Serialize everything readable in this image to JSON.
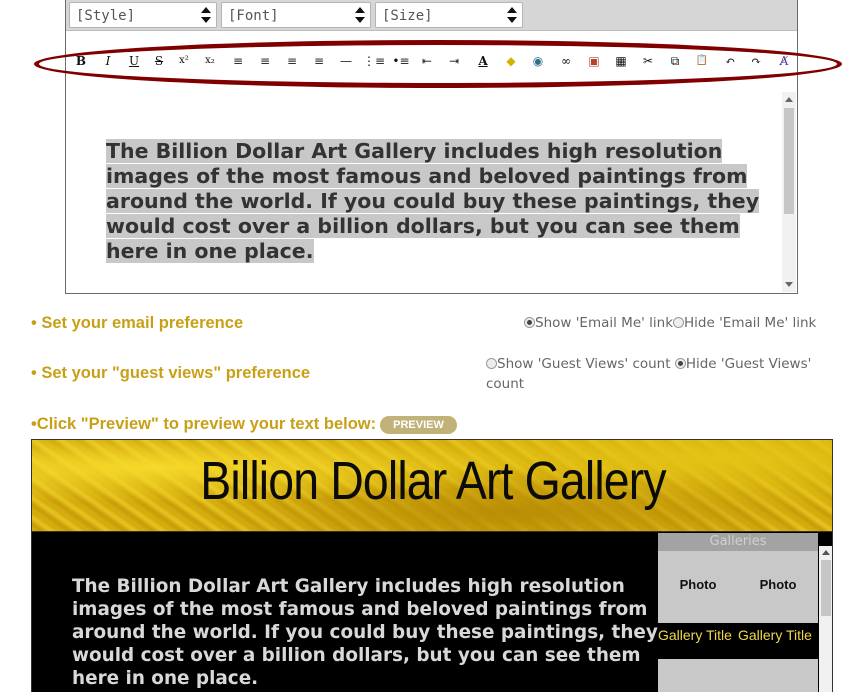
{
  "editor": {
    "style_select": "[Style]",
    "font_select": "[Font]",
    "size_select": "[Size]",
    "toolbar": [
      {
        "name": "bold-button",
        "glyph": "B"
      },
      {
        "name": "italic-button",
        "glyph": "I"
      },
      {
        "name": "underline-button",
        "glyph": "U"
      },
      {
        "name": "strikethrough-button",
        "glyph": "S"
      },
      {
        "name": "superscript-button",
        "glyph": "x²"
      },
      {
        "name": "subscript-button",
        "glyph": "x₂"
      },
      {
        "name": "align-left-button",
        "glyph": "≡"
      },
      {
        "name": "align-center-button",
        "glyph": "≡"
      },
      {
        "name": "align-right-button",
        "glyph": "≡"
      },
      {
        "name": "justify-button",
        "glyph": "≡"
      },
      {
        "name": "horizontal-rule-button",
        "glyph": "—"
      },
      {
        "name": "ordered-list-button",
        "glyph": "⋮≡"
      },
      {
        "name": "unordered-list-button",
        "glyph": "•≡"
      },
      {
        "name": "outdent-button",
        "glyph": "⇤"
      },
      {
        "name": "indent-button",
        "glyph": "⇥"
      },
      {
        "name": "text-color-button",
        "glyph": "A"
      },
      {
        "name": "highlight-button",
        "glyph": "◆"
      },
      {
        "name": "insert-image-button",
        "glyph": "◉"
      },
      {
        "name": "insert-link-button",
        "glyph": "∞"
      },
      {
        "name": "insert-object-button",
        "glyph": "▣"
      },
      {
        "name": "insert-table-button",
        "glyph": "▦"
      },
      {
        "name": "cut-button",
        "glyph": "✂"
      },
      {
        "name": "copy-button",
        "glyph": "⧉"
      },
      {
        "name": "paste-button",
        "glyph": "📋"
      },
      {
        "name": "undo-button",
        "glyph": "↶"
      },
      {
        "name": "redo-button",
        "glyph": "↷"
      },
      {
        "name": "clear-format-button",
        "glyph": "A̸"
      }
    ],
    "content": "The Billion Dollar Art Gallery includes high resolution images of the most famous and beloved paintings from around the world. If you could buy these paintings, they would cost over a billion dollars, but you can see them here in one place."
  },
  "preferences": {
    "email_label": "• Set your email preference",
    "email_show": "Show 'Email Me' link",
    "email_hide": "Hide 'Email Me' link",
    "guest_label": "• Set your \"guest views\" preference",
    "guest_show": "Show 'Guest Views' count",
    "guest_hide": "Hide 'Guest Views' count",
    "preview_label": "•Click \"Preview\" to preview your text below:",
    "preview_button": "PREVIEW"
  },
  "preview": {
    "banner_title": "Billion Dollar Art Gallery",
    "text": "The Billion Dollar Art Gallery includes high resolution images of the most famous and beloved paintings from around the world. If you could buy these paintings, they would cost over a billion dollars, but you can see them here in one place.",
    "galleries_heading": "Galleries",
    "photo_1": "Photo",
    "photo_2": "Photo",
    "gallery_title_1": "Gallery Title",
    "gallery_title_2": "Gallery Title"
  },
  "colors": {
    "accent_gold": "#c8a017",
    "ring_maroon": "#800000",
    "preview_bg": "#000000"
  }
}
